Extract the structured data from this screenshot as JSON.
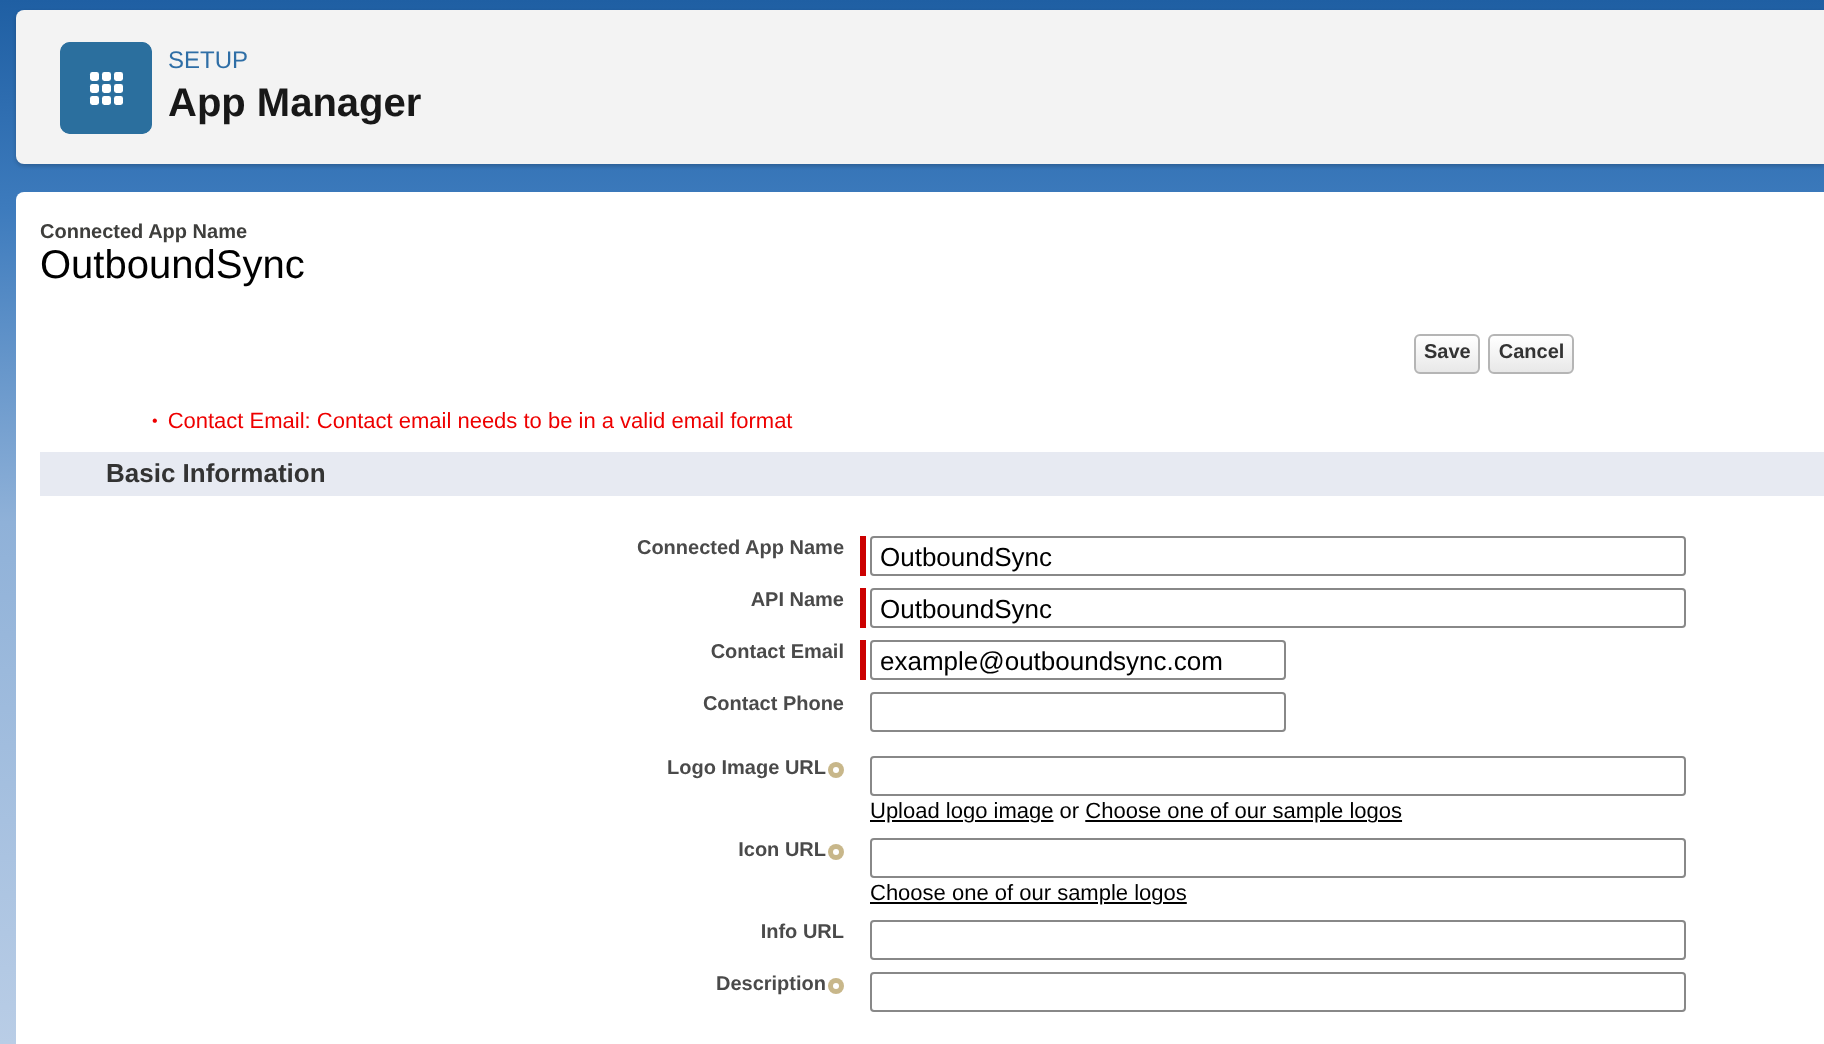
{
  "header": {
    "eyebrow": "SETUP",
    "title": "App Manager"
  },
  "record": {
    "label": "Connected App Name",
    "name": "OutboundSync"
  },
  "buttons": [
    "Save",
    "Cancel"
  ],
  "errors": [
    {
      "marker": "•",
      "text": "Contact Email: Contact email needs to be in a valid email format"
    }
  ],
  "section": {
    "title": "Basic Information"
  },
  "fields": [
    {
      "label": "Connected App Name",
      "value": "OutboundSync",
      "required": true,
      "help": false,
      "short": false
    },
    {
      "label": "API Name",
      "value": "OutboundSync",
      "required": true,
      "help": false,
      "short": false
    },
    {
      "label": "Contact Email",
      "value": "example@outboundsync.com",
      "required": true,
      "help": false,
      "short": true
    },
    {
      "label": "Contact Phone",
      "required": false,
      "help": false,
      "short": true
    },
    {
      "label": "Logo Image URL",
      "required": false,
      "help": true,
      "short": false,
      "hint": [
        {
          "kind": "link",
          "text": "Upload logo image"
        },
        {
          "kind": "text",
          "text": "or"
        },
        {
          "kind": "link",
          "text": "Choose one of our sample logos"
        }
      ]
    },
    {
      "label": "Icon URL",
      "required": false,
      "help": true,
      "short": false,
      "hint": [
        {
          "kind": "link",
          "text": "Choose one of our sample logos"
        }
      ]
    },
    {
      "label": "Info URL",
      "required": false,
      "help": false,
      "short": false
    },
    {
      "label": "Description",
      "required": false,
      "help": true,
      "short": false
    }
  ]
}
